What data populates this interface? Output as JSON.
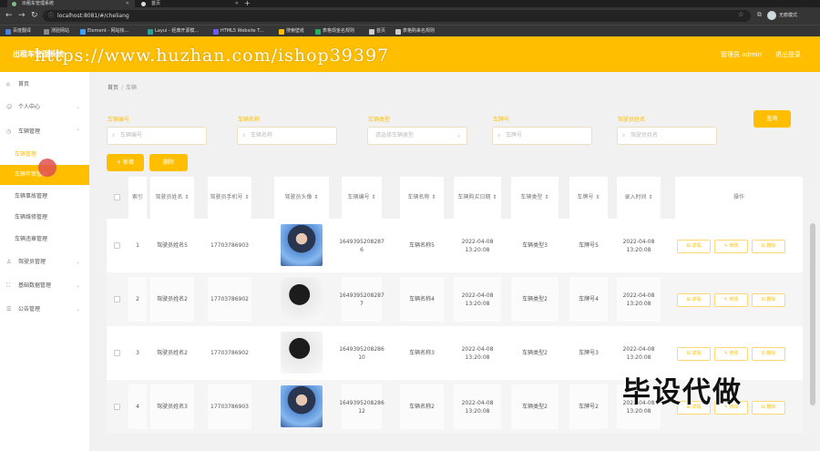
{
  "browser": {
    "tabs": [
      {
        "title": "出租车管理系统"
      },
      {
        "title": "首页"
      }
    ],
    "url": "localhost:8081/#/cheliang",
    "profile_label": "无痕模式",
    "bookmarks": [
      {
        "label": "百度翻译",
        "color": "#4a7fe0"
      },
      {
        "label": "测验网站",
        "color": "#888888"
      },
      {
        "label": "Element - 网站快...",
        "color": "#409eff"
      },
      {
        "label": "Layui - 经典开源模...",
        "color": "#2aa198"
      },
      {
        "label": "HTML5 Website T...",
        "color": "#6c5ce7"
      },
      {
        "label": "搜索壁纸",
        "color": "#ffbf00"
      },
      {
        "label": "表格现金名规则",
        "color": "#27ae60"
      },
      {
        "label": "首页",
        "color": "#cccccc"
      },
      {
        "label": "表格购来名规则",
        "color": "#cccccc"
      }
    ]
  },
  "header": {
    "title": "出租车管理系统",
    "admin_label": "管理员 admin",
    "logout_label": "退出登录"
  },
  "watermark_text": "https://www.huzhan.com/ishop39397",
  "overlay_text": "毕设代做",
  "sidebar": {
    "items": [
      {
        "label": "首页",
        "icon": "home-icon",
        "glyph": "⌂"
      },
      {
        "label": "个人中心",
        "icon": "user-icon",
        "glyph": "☺",
        "chevron": "⌄"
      },
      {
        "label": "车辆管理",
        "icon": "car-icon",
        "glyph": "◷",
        "chevron": "⌃"
      }
    ],
    "subitems": [
      {
        "label": "车辆管理"
      },
      {
        "label": "车辆年审管理"
      },
      {
        "label": "车辆事故管理"
      },
      {
        "label": "车辆维修管理"
      },
      {
        "label": "车辆违章管理"
      }
    ],
    "more_items": [
      {
        "label": "驾驶员管理",
        "icon": "driver-icon",
        "glyph": "♙",
        "chevron": "⌄"
      },
      {
        "label": "基础数据管理",
        "icon": "data-icon",
        "glyph": "⛶",
        "chevron": "⌄"
      },
      {
        "label": "公告管理",
        "icon": "notice-icon",
        "glyph": "☰",
        "chevron": "⌄"
      }
    ]
  },
  "breadcrumb": {
    "home": "首页",
    "current": "车辆"
  },
  "filters": [
    {
      "label": "车辆编号",
      "placeholder": "车辆编号",
      "type": "input"
    },
    {
      "label": "车辆名称",
      "placeholder": "车辆名称",
      "type": "input"
    },
    {
      "label": "车辆类型",
      "placeholder": "请选择车辆类型",
      "type": "select"
    },
    {
      "label": "车牌号",
      "placeholder": "车牌号",
      "type": "input"
    },
    {
      "label": "驾驶员姓名",
      "placeholder": "驾驶员姓名",
      "type": "input"
    }
  ],
  "buttons": {
    "search": "查询",
    "add": "+ 新增",
    "delete": "删除"
  },
  "table": {
    "columns": [
      "索引",
      "驾驶员姓名 ⇕",
      "驾驶员手机号 ⇕",
      "驾驶员头像 ⇕",
      "车辆编号 ⇕",
      "车辆名称 ⇕",
      "车辆购买日期 ⇕",
      "车辆类型 ⇕",
      "车牌号 ⇕",
      "录入时间 ⇕",
      "操作"
    ],
    "action_labels": {
      "detail": "详情",
      "edit": "修改",
      "delete": "删除"
    },
    "rows": [
      {
        "index": "1",
        "driver": "驾驶员姓名5",
        "phone": "17703786903",
        "avatar": "blue",
        "code": "1649395208287 6",
        "name": "车辆名称5",
        "buy_date": "2022-04-08 13:20:08",
        "type": "车辆类型3",
        "plate": "车牌号5",
        "created": "2022-04-08 13:20:08"
      },
      {
        "index": "2",
        "driver": "驾驶员姓名2",
        "phone": "17703786902",
        "avatar": "dark",
        "code": "1649395208287 7",
        "name": "车辆名称4",
        "buy_date": "2022-04-08 13:20:08",
        "type": "车辆类型2",
        "plate": "车牌号4",
        "created": "2022-04-08 13:20:08"
      },
      {
        "index": "3",
        "driver": "驾驶员姓名2",
        "phone": "17703786902",
        "avatar": "dark",
        "code": "1649395208286 10",
        "name": "车辆名称3",
        "buy_date": "2022-04-08 13:20:08",
        "type": "车辆类型2",
        "plate": "车牌号3",
        "created": "2022-04-08 13:20:08"
      },
      {
        "index": "4",
        "driver": "驾驶员姓名3",
        "phone": "17703786903",
        "avatar": "blue",
        "code": "1649395208286 12",
        "name": "车辆名称2",
        "buy_date": "2022-04-08 13:20:08",
        "type": "车辆类型2",
        "plate": "车牌号2",
        "created": "2022-04-08 13:20:08"
      }
    ]
  }
}
